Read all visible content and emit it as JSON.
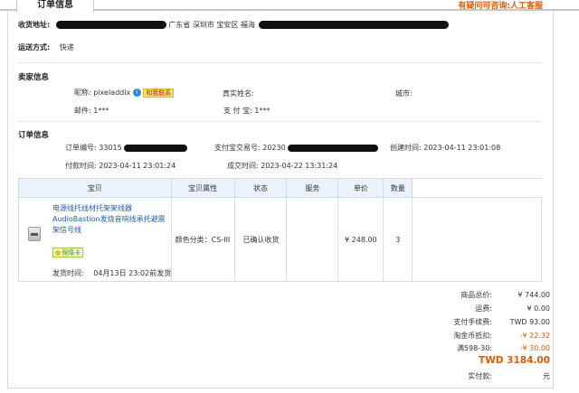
{
  "tab": {
    "title": "订单信息"
  },
  "help": {
    "text": "有疑问可咨询:人工客服"
  },
  "shipping": {
    "address_label": "收货地址:",
    "address_text": "广东省 深圳市 宝安区 福海",
    "method_label": "运送方式:",
    "method_value": "快递"
  },
  "seller": {
    "section_title": "卖家信息",
    "nickname_label": "昵称:",
    "nickname_value": "pixeladdix",
    "chat_badge": "和我联系",
    "realname_label": "真实姓名:",
    "city_label": "城市:",
    "email_label": "邮件:",
    "email_value": "1***",
    "alipay_label": "支 付 宝:",
    "alipay_value": "1***"
  },
  "order": {
    "section_title": "订单信息",
    "number_label": "订单编号:",
    "number_value": "33015",
    "trade_label": "支付宝交易号:",
    "trade_value": "20230",
    "created_label": "创建时间:",
    "created_value": "2023-04-11 23:01:08",
    "paid_label": "付款时间:",
    "paid_value": "2023-04-11 23:01:24",
    "deal_label": "成交时间:",
    "deal_value": "2023-04-22 13:31:24"
  },
  "table": {
    "headers": [
      "宝贝",
      "宝贝属性",
      "状态",
      "服务",
      "单价",
      "数量"
    ],
    "item": {
      "title": "电源线托线材托架架线器AudioBastion发烧音响线承托避震架信号线",
      "tag": "保障卡",
      "ship_label": "发货时间:",
      "ship_value": "04月13日 23:02前发货",
      "attr": "颜色分类：CS-III",
      "status": "已确认收货",
      "service": "",
      "price": "¥ 248.00",
      "qty": "3"
    }
  },
  "summary": {
    "goods_label": "商品总价:",
    "goods_value": "¥ 744.00",
    "freight_label": "运费:",
    "freight_value": "¥ 0.00",
    "fee_label": "支付手续费:",
    "fee_value": "TWD 93.00",
    "coin_label": "淘金币抵扣:",
    "coin_value": "-¥ 22.32",
    "discount_label": "满598-30:",
    "discount_value": "-¥ 30.00",
    "total_value": "TWD 3184.00",
    "paid_label": "实付款:",
    "paid_unit": "元"
  },
  "colors": {
    "accent": "#e05a00",
    "link": "#1a5fb4",
    "header_bg": "#eaf3fb"
  }
}
